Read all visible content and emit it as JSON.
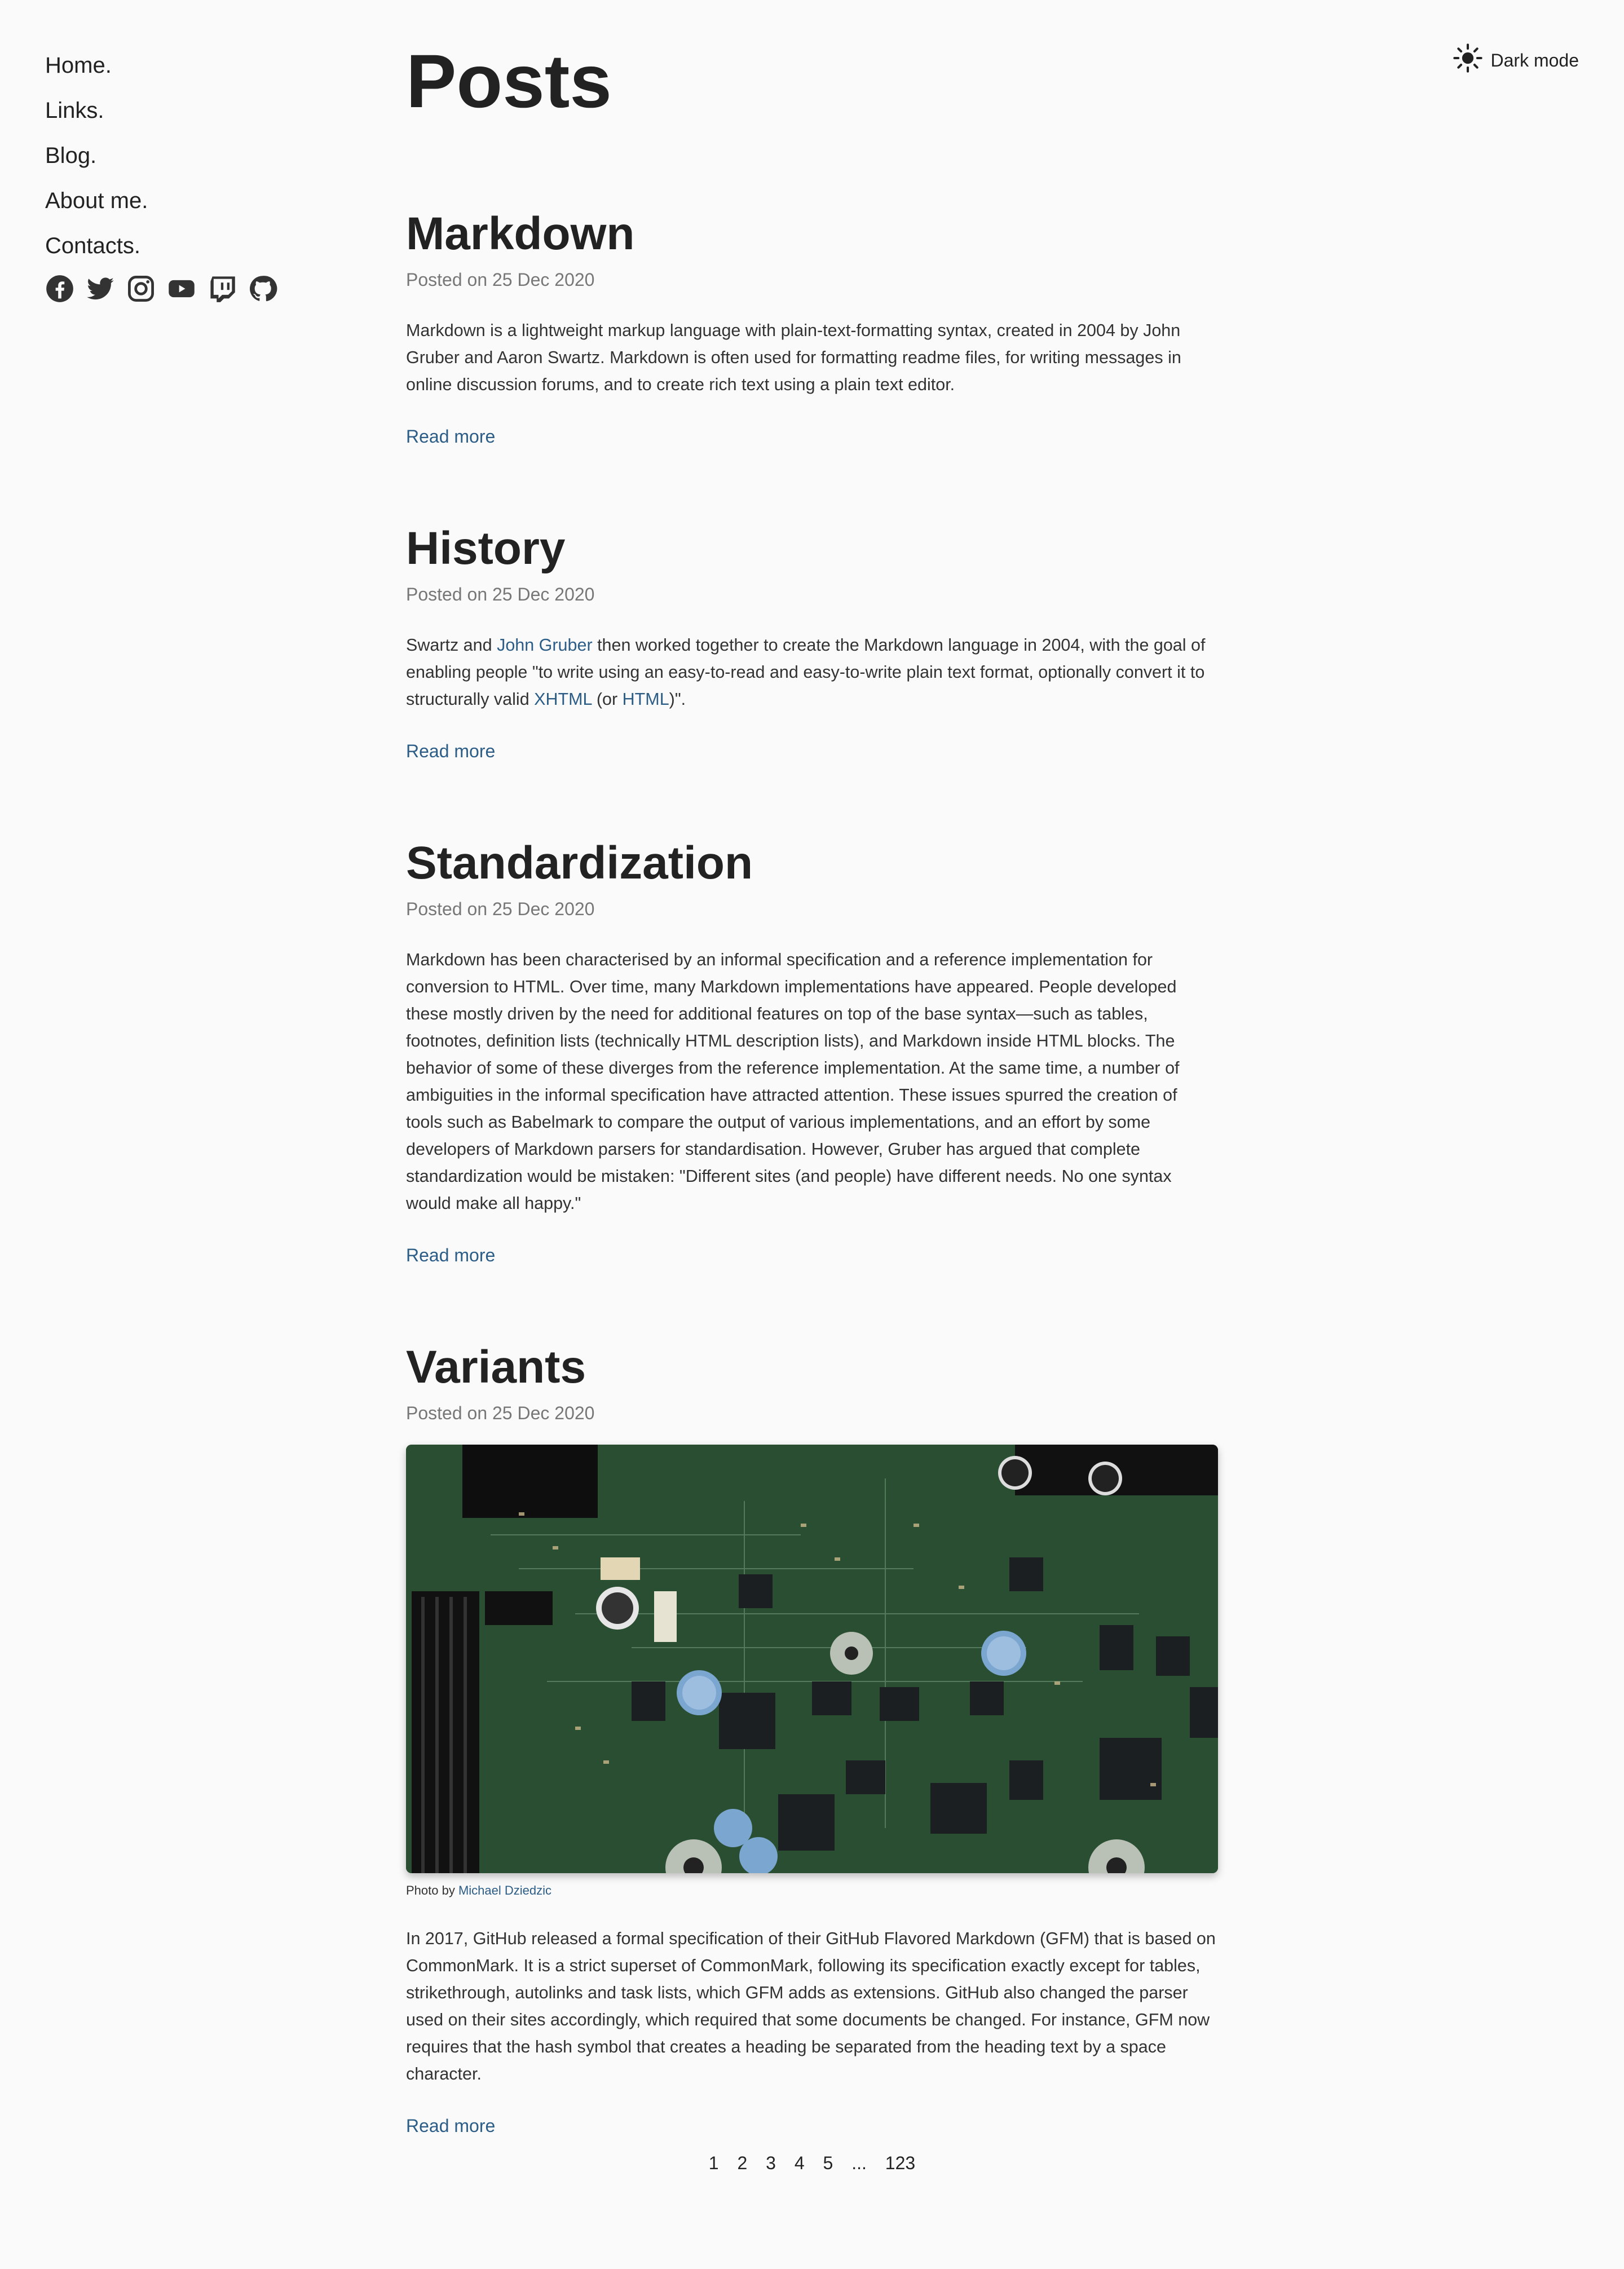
{
  "nav": {
    "items": [
      {
        "label": "Home."
      },
      {
        "label": "Links."
      },
      {
        "label": "Blog."
      },
      {
        "label": "About me."
      },
      {
        "label": "Contacts."
      }
    ],
    "social_icons": [
      "facebook-icon",
      "twitter-icon",
      "instagram-icon",
      "youtube-icon",
      "twitch-icon",
      "github-icon"
    ]
  },
  "theme_toggle": {
    "label": "Dark mode",
    "icon": "sun-icon"
  },
  "page": {
    "title": "Posts"
  },
  "posts": [
    {
      "title": "Markdown",
      "meta": "Posted on 25 Dec 2020",
      "body": "Markdown is a lightweight markup language with plain-text-formatting syntax, created in 2004 by John Gruber and Aaron Swartz. Markdown is often used for formatting readme files, for writing messages in online discussion forums, and to create rich text using a plain text editor.",
      "read_more": "Read more"
    },
    {
      "title": "History",
      "meta": "Posted on 25 Dec 2020",
      "body_parts": {
        "p1": "Swartz and ",
        "link1": "John Gruber",
        "p2": " then worked together to create the Markdown language in 2004, with the goal of enabling people \"to write using an easy-to-read and easy-to-write plain text format, optionally convert it to structurally valid ",
        "link2": "XHTML",
        "p3": " (or ",
        "link3": "HTML",
        "p4": ")\"."
      },
      "read_more": "Read more"
    },
    {
      "title": "Standardization",
      "meta": "Posted on 25 Dec 2020",
      "body": "Markdown has been characterised by an informal specification and a reference implementation for conversion to HTML. Over time, many Markdown implementations have appeared. People developed these mostly driven by the need for additional features on top of the base syntax—such as tables, footnotes, definition lists (technically HTML description lists), and Markdown inside HTML blocks. The behavior of some of these diverges from the reference implementation. At the same time, a number of ambiguities in the informal specification have attracted attention. These issues spurred the creation of tools such as Babelmark to compare the output of various implementations, and an effort by some developers of Markdown parsers for standardisation. However, Gruber has argued that complete standardization would be mistaken: \"Different sites (and people) have different needs. No one syntax would make all happy.\"",
      "read_more": "Read more"
    },
    {
      "title": "Variants",
      "meta": "Posted on 25 Dec 2020",
      "caption_prefix": "Photo by ",
      "caption_link": "Michael Dziedzic",
      "body": "In 2017, GitHub released a formal specification of their GitHub Flavored Markdown (GFM) that is based on CommonMark. It is a strict superset of CommonMark, following its specification exactly except for tables, strikethrough, autolinks and task lists, which GFM adds as extensions. GitHub also changed the parser used on their sites accordingly, which required that some documents be changed. For instance, GFM now requires that the hash symbol that creates a heading be separated from the heading text by a space character.",
      "read_more": "Read more"
    }
  ],
  "pagination": {
    "pages": [
      "1",
      "2",
      "3",
      "4",
      "5",
      "...",
      "123"
    ]
  }
}
